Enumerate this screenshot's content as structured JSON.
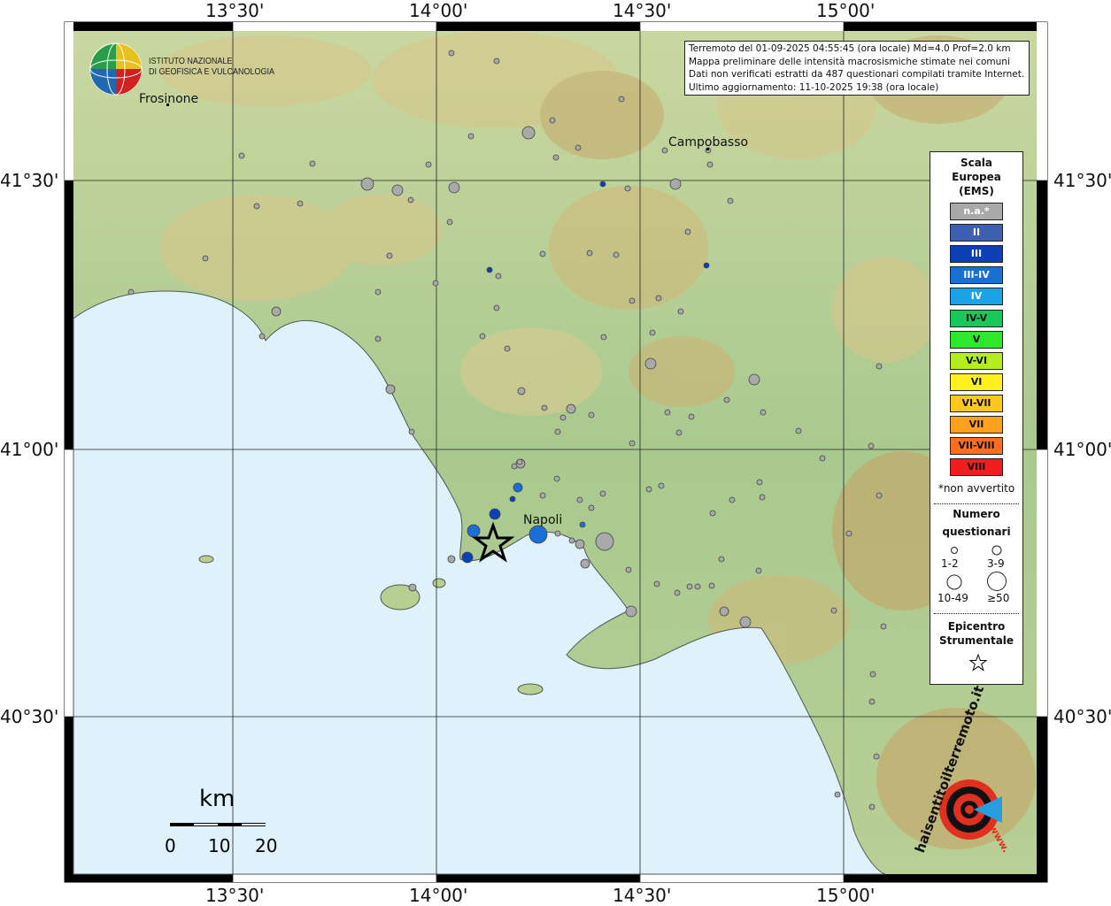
{
  "info": {
    "line1": "Terremoto del 01-09-2025 04:55:45 (ora locale) Md=4.0 Prof=2.0 km",
    "line2": "Mappa preliminare delle intensità macrosismiche stimate nei comuni",
    "line3": "Dati non verificati estratti da 487 questionari compilati tramite Internet.",
    "line4": "Ultimo aggiornamento: 11-10-2025 19:38 (ora locale)"
  },
  "axes": {
    "top": [
      "13°30'",
      "14°00'",
      "14°30'",
      "15°00'"
    ],
    "bottom": [
      "13°30'",
      "14°00'",
      "14°30'",
      "15°00'"
    ],
    "left": [
      "41°30'",
      "41°00'",
      "40°30'"
    ],
    "right": [
      "41°30'",
      "41°00'",
      "40°30'"
    ]
  },
  "logo": {
    "line1": "ISTITUTO NAZIONALE",
    "line2": "DI GEOFISICA E VULCANOLOGIA"
  },
  "cities": {
    "frosinone": "Frosinone",
    "campobasso": "Campobasso",
    "napoli": "Napoli"
  },
  "legend": {
    "title1": "Scala",
    "title2": "Europea",
    "title3": "(EMS)",
    "items": [
      {
        "label": "n.a.*",
        "color": "#a9a9a9"
      },
      {
        "label": "II",
        "color": "#3d5fb0"
      },
      {
        "label": "III",
        "color": "#0d3fb5"
      },
      {
        "label": "III-IV",
        "color": "#1a6fd6"
      },
      {
        "label": "IV",
        "color": "#1aa3e6"
      },
      {
        "label": "IV-V",
        "color": "#19c85a"
      },
      {
        "label": "V",
        "color": "#2ee82e"
      },
      {
        "label": "V-VI",
        "color": "#b4ee1e"
      },
      {
        "label": "VI",
        "color": "#fff01e"
      },
      {
        "label": "VI-VII",
        "color": "#ffc81e"
      },
      {
        "label": "VII",
        "color": "#ffa01e"
      },
      {
        "label": "VII-VIII",
        "color": "#ff6e1e"
      },
      {
        "label": "VIII",
        "color": "#f01e1e"
      }
    ],
    "not_felt": "*non avvertito",
    "count_title1": "Numero",
    "count_title2": "questionari",
    "count_labels": [
      "1-2",
      "3-9",
      "10-49",
      "≥50"
    ],
    "epicenter_title1": "Epicentro",
    "epicenter_title2": "Strumentale"
  },
  "scalebar": {
    "unit": "km",
    "labels": [
      "0",
      "10",
      "20"
    ]
  },
  "brand": {
    "text": "haisentitoilterremoto.it",
    "url": "www."
  }
}
